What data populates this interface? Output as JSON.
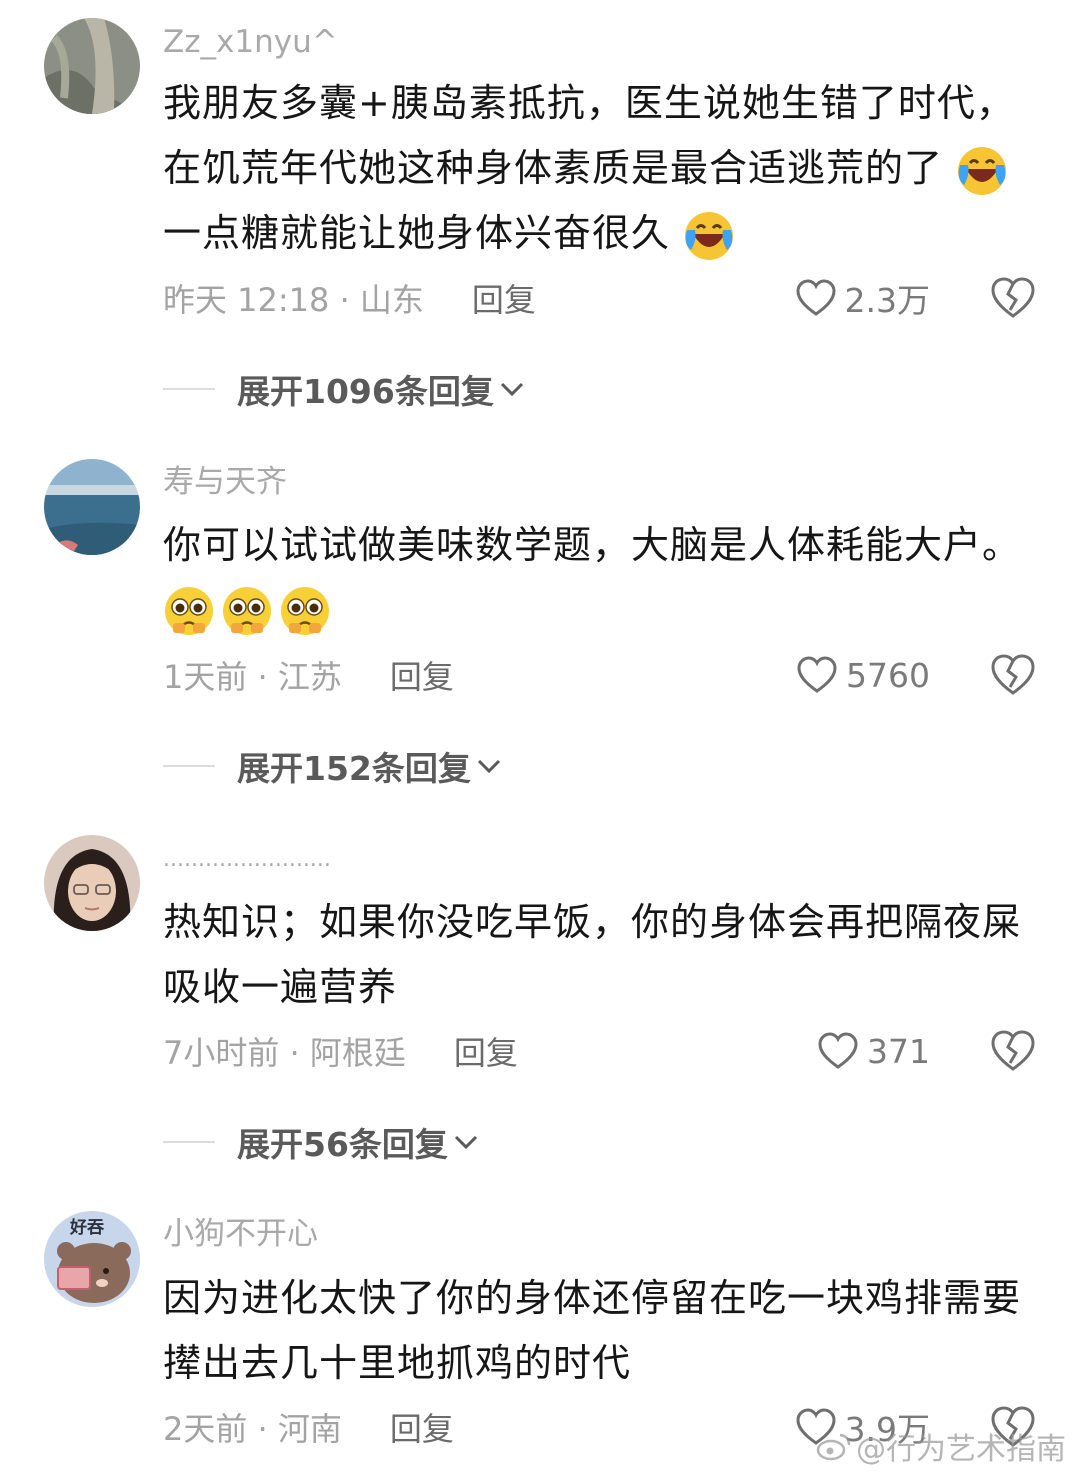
{
  "comments": [
    {
      "username": "Zz_x1nyu^",
      "lines": [
        "我朋友多囊+胰岛素抵抗，医生说她生错了时代，",
        "在饥荒年代她这种身体素质是最合适逃荒的了",
        "一点糖就能让她身体兴奋很久"
      ],
      "meta": "昨天 12:18 · 山东",
      "reply": "回复",
      "likes": "2.3万",
      "expand": "展开1096条回复"
    },
    {
      "username": "寿与天齐",
      "lines": [
        "你可以试试做美味数学题，大脑是人体耗能大户。"
      ],
      "meta": "1天前 · 江苏",
      "reply": "回复",
      "likes": "5760",
      "expand": "展开152条回复"
    },
    {
      "username": "........................",
      "lines": [
        "热知识；如果你没吃早饭，你的身体会再把隔夜屎",
        "吸收一遍营养"
      ],
      "meta": "7小时前 · 阿根廷",
      "reply": "回复",
      "likes": "371",
      "expand": "展开56条回复"
    },
    {
      "username": "小狗不开心",
      "avatar_text": "好吞",
      "lines": [
        "因为进化太快了你的身体还停留在吃一块鸡排需要",
        "撵出去几十里地抓鸡的时代"
      ],
      "meta": "2天前 · 河南",
      "reply": "回复",
      "likes": "3.9万"
    }
  ],
  "watermark": "@行为艺术指南",
  "icons": {
    "like": "heart-outline-icon",
    "dislike": "broken-heart-icon",
    "expand": "chevron-down-icon",
    "emoji_laugh": "laughing-tears-emoji",
    "emoji_pleading": "pleading-face-emoji"
  }
}
